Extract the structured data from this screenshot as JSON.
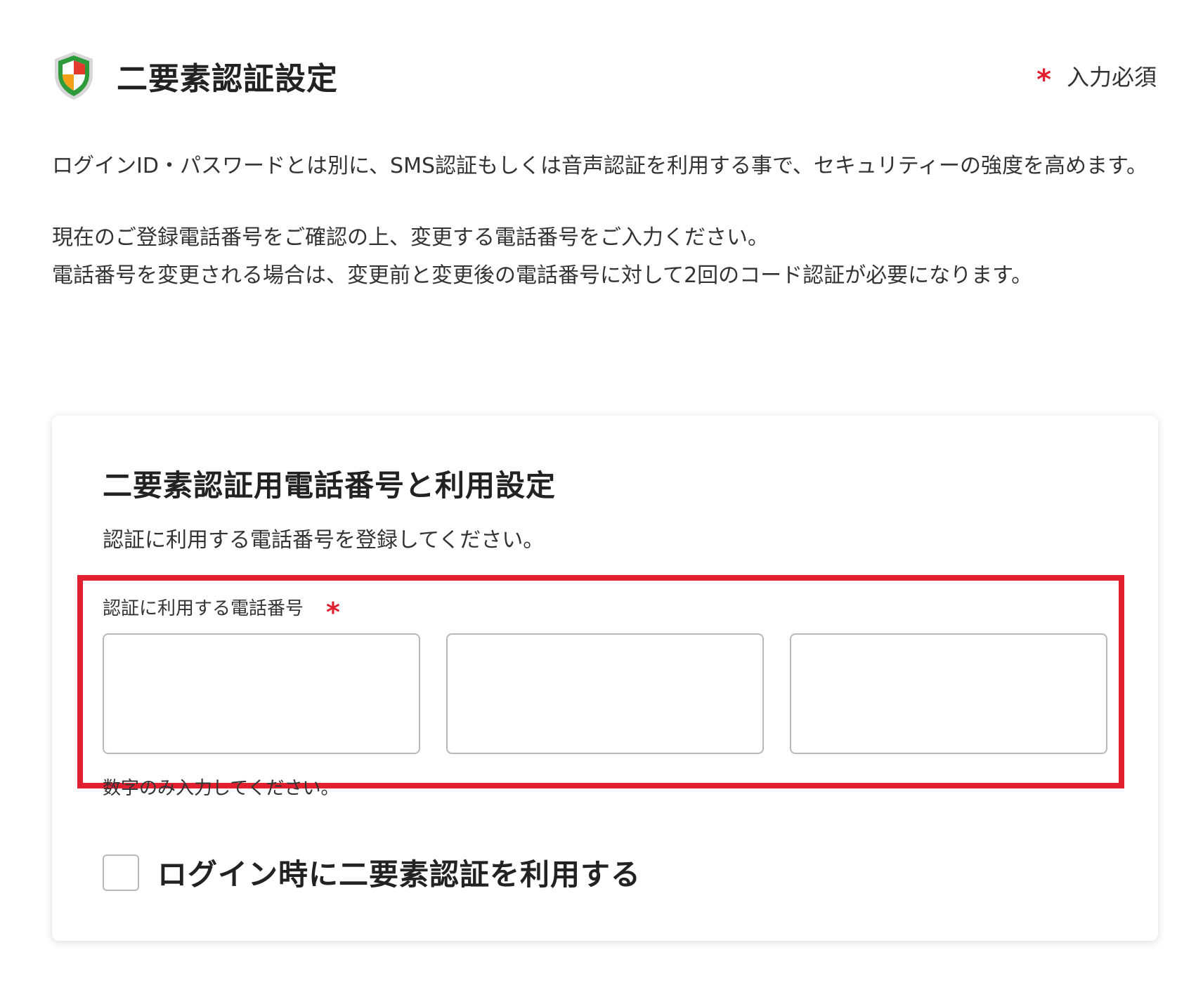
{
  "header": {
    "title": "二要素認証設定",
    "required_mark": "*",
    "required_label": "入力必須"
  },
  "intro": {
    "paragraph1": "ログインID・パスワードとは別に、SMS認証もしくは音声認証を利用する事で、セキュリティーの強度を高めます。",
    "paragraph2_line1": "現在のご登録電話番号をご確認の上、変更する電話番号をご入力ください。",
    "paragraph2_line2": "電話番号を変更される場合は、変更前と変更後の電話番号に対して2回のコード認証が必要になります。"
  },
  "card": {
    "title": "二要素認証用電話番号と利用設定",
    "subtitle": "認証に利用する電話番号を登録してください。",
    "phone_field": {
      "label": "認証に利用する電話番号",
      "required_mark": "*",
      "values": [
        "",
        "",
        ""
      ],
      "help_text": "数字のみ入力してください。"
    },
    "two_factor_checkbox": {
      "label": "ログイン時に二要素認証を利用する",
      "checked": false
    }
  },
  "colors": {
    "accent_red": "#e0202e",
    "shield_green": "#2e9b3b",
    "shield_red": "#e23b2e",
    "shield_orange": "#f4a019"
  },
  "icons": {
    "shield": "shield-icon"
  }
}
